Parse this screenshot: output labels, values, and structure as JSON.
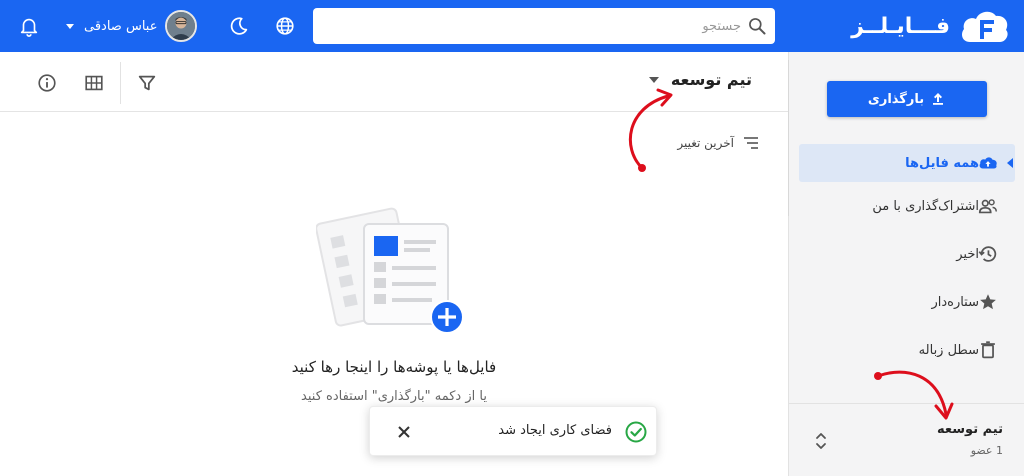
{
  "header": {
    "app_name": "فـــایـلــز",
    "search": {
      "placeholder": "جستجو",
      "value": ""
    },
    "user": {
      "name": "عباس صادقی"
    },
    "icons": [
      "cloud-f-logo-icon",
      "search-icon",
      "globe-icon",
      "moon-icon",
      "chevron-down-icon",
      "bell-icon"
    ]
  },
  "sidebar": {
    "upload_label": "بارگذاری",
    "items": [
      {
        "label": "همه فایل‌ها",
        "icon": "cloud-upload-icon",
        "active": true
      },
      {
        "label": "اشتراک‌گذاری با من",
        "icon": "people-icon",
        "active": false
      },
      {
        "label": "اخیر",
        "icon": "history-icon",
        "active": false
      },
      {
        "label": "ستاره‌دار",
        "icon": "star-icon",
        "active": false
      },
      {
        "label": "سطل زباله",
        "icon": "trash-icon",
        "active": false
      }
    ],
    "workspace": {
      "name": "تیم توسعه",
      "members": "1 عضو"
    }
  },
  "main": {
    "title": "تیم توسعه",
    "sort_label": "آخرین تغییر",
    "empty": {
      "title": "فایل‌ها یا پوشه‌ها را اینجا رها کنید",
      "subtitle": "یا از دکمه \"بارگذاری\" استفاده کنید"
    },
    "toolbar_icons": [
      "filter-icon",
      "grid-view-icon",
      "info-icon"
    ]
  },
  "toast": {
    "message": "فضای کاری ایجاد شد",
    "icon": "check-circle-icon"
  },
  "colors": {
    "brand": "#1a66f2",
    "success": "#28a745",
    "annotation": "#dd0e1c",
    "sidebar_bg": "#f4f4f5",
    "active_bg": "#dde7f6"
  }
}
